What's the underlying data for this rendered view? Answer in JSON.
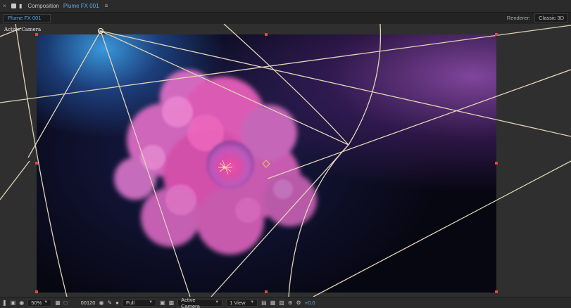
{
  "header": {
    "close": "×",
    "composition_label": "Composition",
    "composition_name": "Plume FX 001",
    "menu": "≡"
  },
  "tabs": [
    {
      "label": "Plume FX 001"
    }
  ],
  "renderer": {
    "label": "Renderer:",
    "value": "Classic 3D"
  },
  "viewer": {
    "view_label": "Active Camera"
  },
  "bottom_bar": {
    "zoom": "50%",
    "timecode": "00120",
    "resolution": "Full",
    "view": "Active Camera",
    "layout": "1 View",
    "exposure": "+0.0"
  },
  "colors": {
    "accent": "#5aa9e6",
    "guide_line": "#dfd3b8",
    "handle": "#e04a3a"
  }
}
